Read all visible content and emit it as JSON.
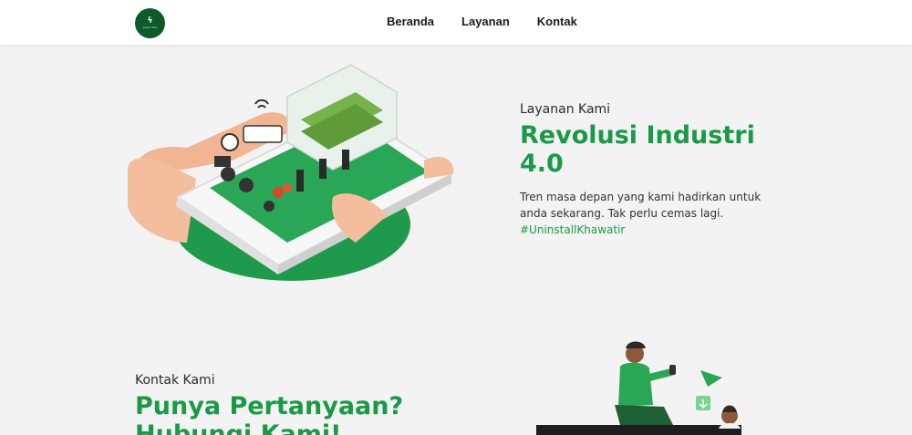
{
  "brand": {
    "logo_mark": "ϟ",
    "logo_text": "warno tani"
  },
  "nav": {
    "items": [
      "Beranda",
      "Layanan",
      "Kontak"
    ]
  },
  "services": {
    "eyebrow": "Layanan Kami",
    "heading": "Revolusi Industri 4.0",
    "description": "Tren masa depan yang kami hadirkan untuk anda sekarang. Tak perlu cemas lagi.",
    "hashtag": "#UninstallKhawatir"
  },
  "contact": {
    "eyebrow": "Kontak Kami",
    "heading": "Punya Pertanyaan? Hubungi Kami!"
  },
  "colors": {
    "brand_green": "#1a9a48",
    "dark_green": "#0f5a2a",
    "background": "#f3f3f3"
  }
}
